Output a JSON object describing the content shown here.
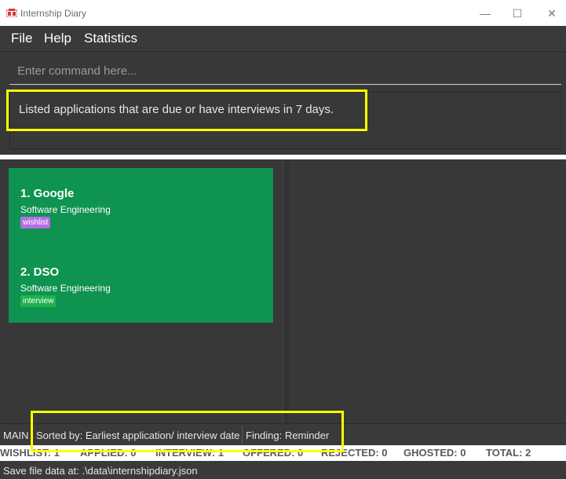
{
  "window": {
    "title": "Internship Diary",
    "minimize_glyph": "—",
    "maximize_glyph": "☐",
    "close_glyph": "✕"
  },
  "menu": {
    "items": [
      "File",
      "Help",
      "Statistics"
    ]
  },
  "command": {
    "placeholder": "Enter command here..."
  },
  "result": {
    "text": "Listed applications that are due or have interviews in 7 days."
  },
  "applications": [
    {
      "index_title": "1.  Google",
      "role": "Software Engineering",
      "tag": "wishlist"
    },
    {
      "index_title": "2.  DSO",
      "role": "Software Engineering",
      "tag": "interview"
    }
  ],
  "status": {
    "view": "MAIN",
    "sort": "Sorted by: Earliest application/ interview date",
    "finding": "Finding: Reminder"
  },
  "stats": {
    "wishlist": "WISHLIST: 1",
    "applied": "APPLIED: 0",
    "interview": "INTERVIEW: 1",
    "offered": "OFFERED: 0",
    "rejected": "REJECTED: 0",
    "ghosted": "GHOSTED: 0",
    "total": "TOTAL: 2"
  },
  "footer": {
    "save_location": "Save file data at: .\\data\\internshipdiary.json"
  },
  "colors": {
    "card_background": "#0e9351",
    "tag_wishlist": "#b46ee6",
    "tag_interview": "#1fb34f",
    "highlight": "#ffff00"
  }
}
